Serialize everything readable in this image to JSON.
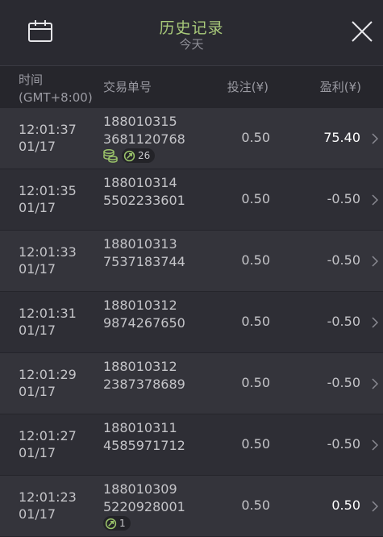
{
  "header": {
    "title": "历史记录",
    "subtitle": "今天"
  },
  "columns": {
    "time_line1": "时间",
    "time_line2": "(GMT+8:00)",
    "order": "交易单号",
    "bet": "投注(¥)",
    "profit": "盈利(¥)"
  },
  "rows": [
    {
      "time": "12:01:37",
      "date": "01/17",
      "order1": "188010315",
      "order2": "3681120768",
      "bet": "0.50",
      "profit": "75.40",
      "win": true,
      "badge_count": "26",
      "has_stack": true
    },
    {
      "time": "12:01:35",
      "date": "01/17",
      "order1": "188010314",
      "order2": "5502233601",
      "bet": "0.50",
      "profit": "-0.50",
      "win": false
    },
    {
      "time": "12:01:33",
      "date": "01/17",
      "order1": "188010313",
      "order2": "7537183744",
      "bet": "0.50",
      "profit": "-0.50",
      "win": false
    },
    {
      "time": "12:01:31",
      "date": "01/17",
      "order1": "188010312",
      "order2": "9874267650",
      "bet": "0.50",
      "profit": "-0.50",
      "win": false
    },
    {
      "time": "12:01:29",
      "date": "01/17",
      "order1": "188010312",
      "order2": "2387378689",
      "bet": "0.50",
      "profit": "-0.50",
      "win": false
    },
    {
      "time": "12:01:27",
      "date": "01/17",
      "order1": "188010311",
      "order2": "4585971712",
      "bet": "0.50",
      "profit": "-0.50",
      "win": false
    },
    {
      "time": "12:01:23",
      "date": "01/17",
      "order1": "188010309",
      "order2": "5220928001",
      "bet": "0.50",
      "profit": "0.50",
      "win": true,
      "badge_count": "1",
      "has_stack": false
    }
  ],
  "icons": {
    "calendar": "calendar-icon",
    "close": "close-icon",
    "chevron": "chevron-right-icon",
    "coins": "coin-stack-icon",
    "free_spin": "spin-arrow-icon"
  },
  "colors": {
    "title": "#a8c97a",
    "badge_icon": "#9bc46a",
    "win_text": "#ffffff"
  }
}
